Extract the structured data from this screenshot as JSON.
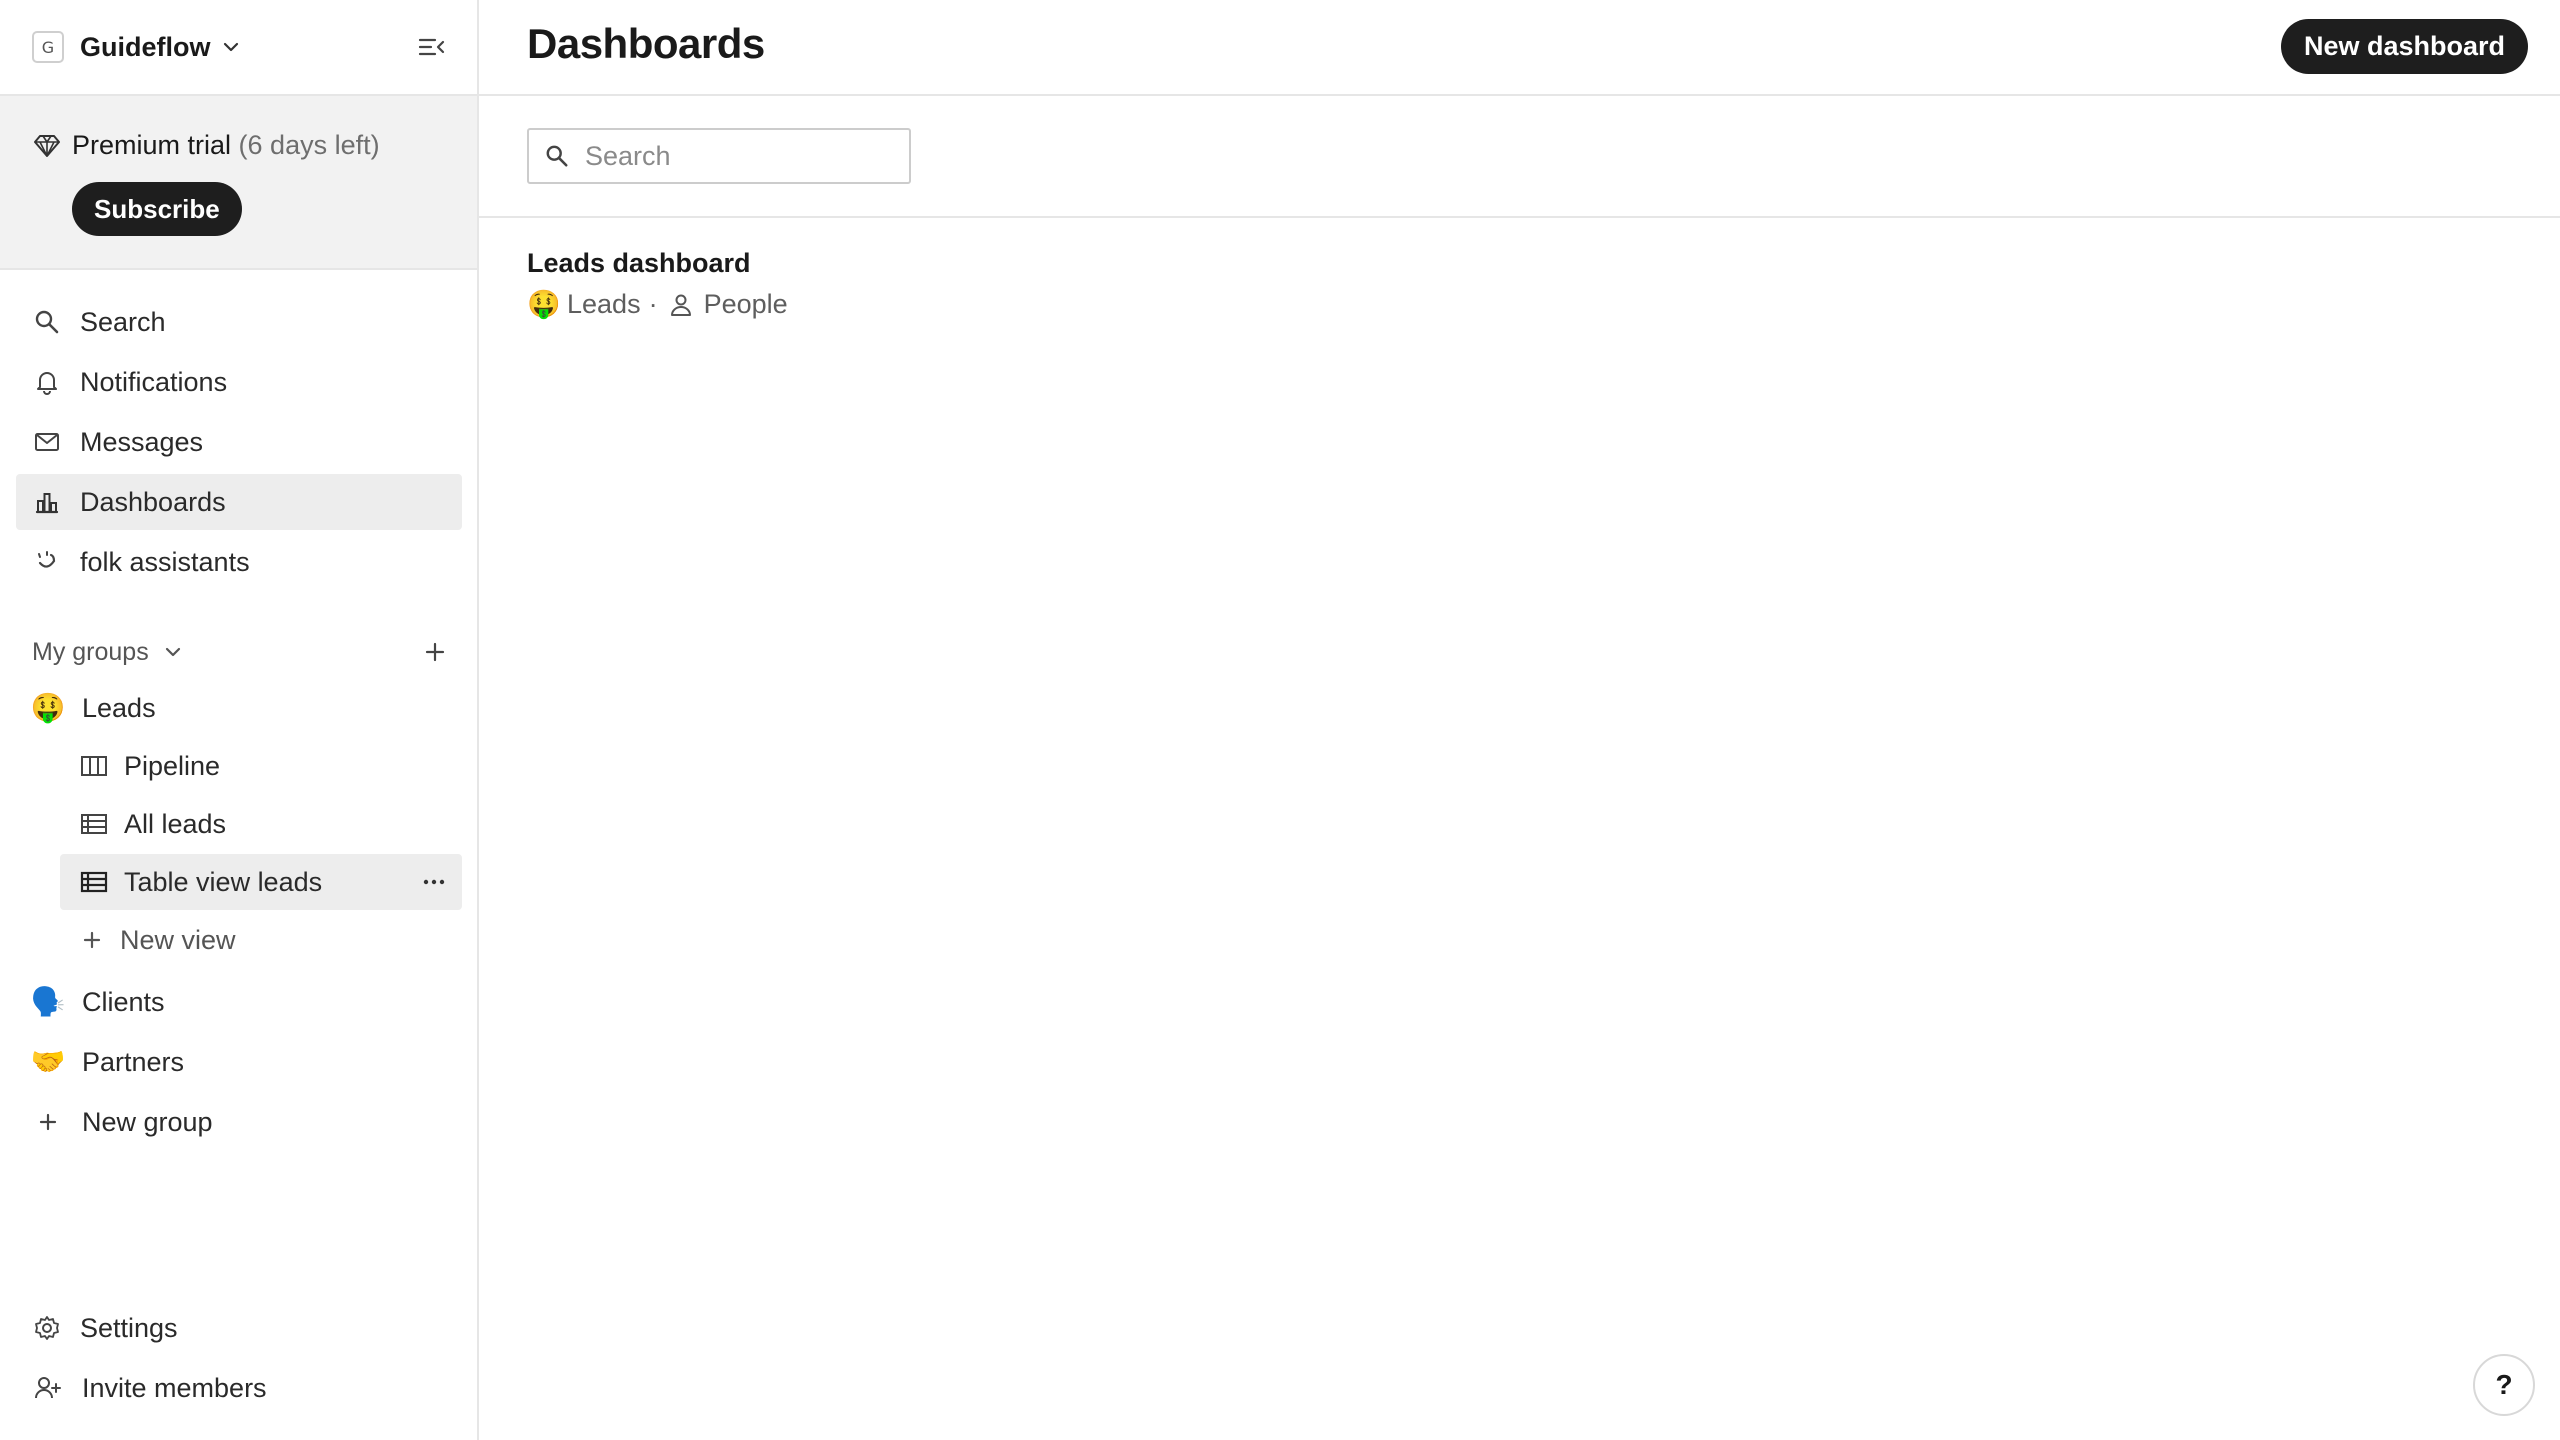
{
  "workspace": {
    "logo_letter": "G",
    "name": "Guideflow"
  },
  "trial": {
    "label": "Premium trial",
    "days_left": "(6 days left)",
    "subscribe_label": "Subscribe"
  },
  "nav": {
    "search": "Search",
    "notifications": "Notifications",
    "messages": "Messages",
    "dashboards": "Dashboards",
    "assistants": "folk assistants"
  },
  "groups": {
    "header": "My groups",
    "leads": {
      "emoji": "🤑",
      "label": "Leads"
    },
    "views": {
      "pipeline": "Pipeline",
      "all_leads": "All leads",
      "table_view": "Table view leads",
      "new_view": "New view"
    },
    "clients": {
      "emoji": "🗣️",
      "label": "Clients"
    },
    "partners": {
      "emoji": "🤝",
      "label": "Partners"
    },
    "new_group": "New group"
  },
  "footer": {
    "settings": "Settings",
    "invite": "Invite members"
  },
  "main": {
    "title": "Dashboards",
    "new_dashboard_label": "New dashboard",
    "search_placeholder": "Search",
    "dashboards": [
      {
        "title": "Leads dashboard",
        "group_emoji": "🤑",
        "group": "Leads",
        "separator": "·",
        "object": "People"
      }
    ]
  },
  "help_label": "?",
  "colors": {
    "primary_button": "#1e1e1e",
    "active_item": "#ededed",
    "trial_bg": "#f2f2f2"
  }
}
